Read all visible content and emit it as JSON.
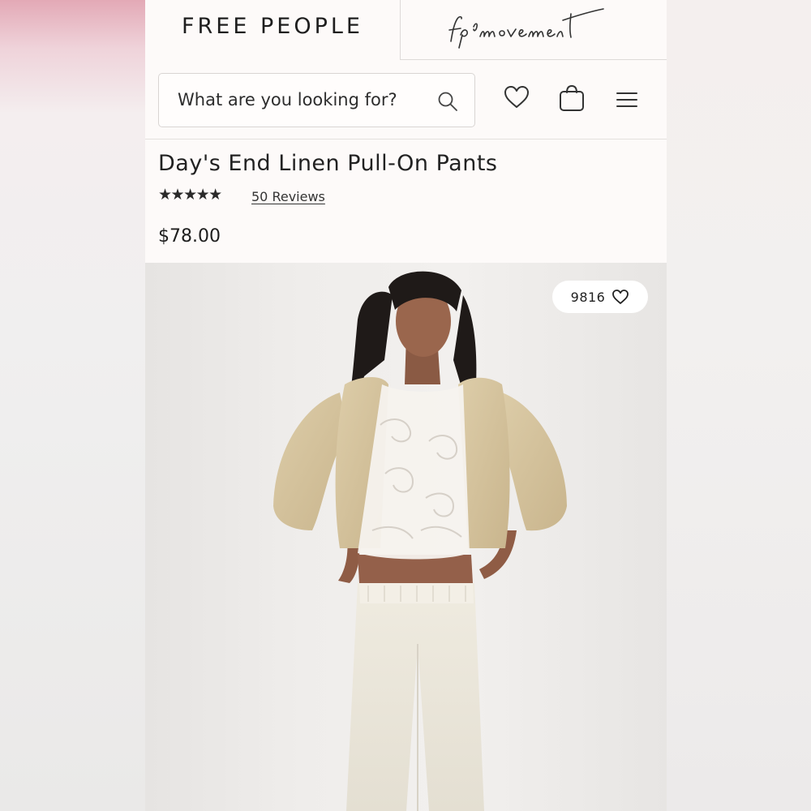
{
  "header": {
    "brand_primary": "FREE PEOPLE",
    "brand_secondary": "fpmovement"
  },
  "search": {
    "placeholder": "What are you looking for?"
  },
  "icons": {
    "search": "search-icon",
    "wishlist": "heart-icon",
    "bag": "shopping-bag-icon",
    "menu": "hamburger-menu-icon",
    "favorite": "heart-outline-icon"
  },
  "product": {
    "title": "Day's End Linen Pull-On Pants",
    "rating_stars": "★★★★★",
    "rating": 5,
    "reviews_label": "50 Reviews",
    "price": "$78.00",
    "favorites_count": "9816"
  },
  "colors": {
    "text": "#222222",
    "background": "#fdfaf9",
    "border": "#d9d5d3"
  }
}
